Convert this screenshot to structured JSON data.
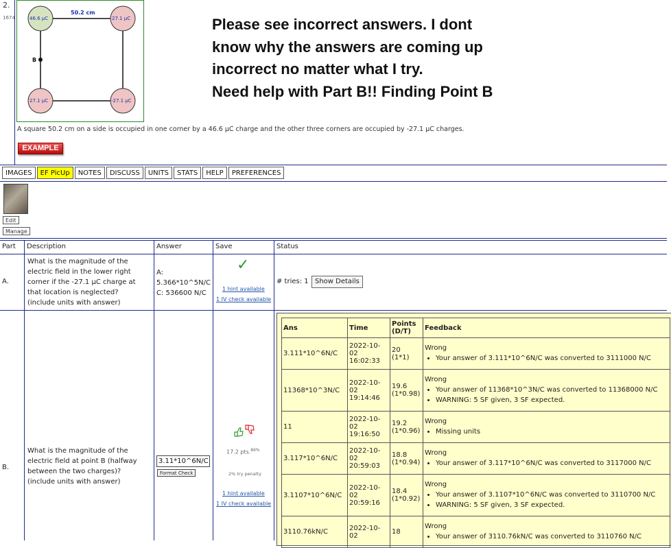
{
  "question": {
    "number": "2.",
    "id": "1674",
    "diagram": {
      "side_label": "50.2 cm",
      "point_label": "B",
      "charges": [
        "46.6 μC",
        "27.1 μC",
        "27.1 μC",
        "-27.1 μC"
      ]
    },
    "problem_text": "A square 50.2 cm on a side is occupied in one corner by a 46.6 μC charge and the other three corners are occupied by -27.1 μC charges.",
    "example_label": "EXAMPLE"
  },
  "note": {
    "lines": [
      "Please see incorrect answers. I dont",
      "know why the answers are coming up",
      "incorrect no matter what I try.",
      "Need help with Part B!! Finding Point B"
    ]
  },
  "tabs": [
    "IMAGES",
    "EF PicUp",
    "NOTES",
    "DISCUSS",
    "UNITS",
    "STATS",
    "HELP",
    "PREFERENCES"
  ],
  "image_panel": {
    "edit": "Edit",
    "manage": "Manage"
  },
  "table": {
    "headers": {
      "part": "Part",
      "description": "Description",
      "answer": "Answer",
      "save": "Save",
      "status": "Status"
    },
    "partA": {
      "part": "A.",
      "description": [
        "What is the magnitude of the",
        "electric field in the lower right",
        "corner if the -27.1 μC charge at",
        "that location is neglected?",
        "(include units with answer)"
      ],
      "answer": [
        "A:",
        "5.366*10^5N/C",
        "C: 536600 N/C"
      ],
      "hint": "1 hint available",
      "check": "1 IV check available",
      "tries": "# tries: 1",
      "show_details": "Show Details"
    },
    "partB": {
      "part": "B.",
      "description": [
        "What is the magnitude of the",
        "electric field at point B (halfway",
        "between the two charges)?",
        "(include units with answer)"
      ],
      "answer_value": "3.11*10^6N/C",
      "format_check": "Format Check",
      "points": "17.2 pts.",
      "points_pct": "86%",
      "penalty": "2% try penalty",
      "hint": "1 hint available",
      "check": "1 IV check available"
    }
  },
  "history": {
    "headers": {
      "ans": "Ans",
      "time": "Time",
      "points_1": "Points",
      "points_2": "(D/T)",
      "feedback": "Feedback"
    },
    "rows": [
      {
        "ans": "3.111*10^6N/C",
        "date": "2022-10-02",
        "time": "16:02:33",
        "points": "20",
        "factor": "(1*1)",
        "status": "Wrong",
        "notes": [
          "Your answer of 3.111*10^6N/C was converted to 3111000 N/C"
        ]
      },
      {
        "ans": "11368*10^3N/C",
        "date": "2022-10-02",
        "time": "19:14:46",
        "points": "19.6",
        "factor": "(1*0.98)",
        "status": "Wrong",
        "notes": [
          "Your answer of 11368*10^3N/C was converted to 11368000 N/C",
          "WARNING: 5 SF given, 3 SF expected."
        ]
      },
      {
        "ans": "11",
        "date": "2022-10-02",
        "time": "19:16:50",
        "points": "19.2",
        "factor": "(1*0.96)",
        "status": "Wrong",
        "notes": [
          "Missing units"
        ]
      },
      {
        "ans": "3.117*10^6N/C",
        "date": "2022-10-02",
        "time": "20:59:03",
        "points": "18.8",
        "factor": "(1*0.94)",
        "status": "Wrong",
        "notes": [
          "Your answer of 3.117*10^6N/C was converted to 3117000 N/C"
        ]
      },
      {
        "ans": "3.1107*10^6N/C",
        "date": "2022-10-02",
        "time": "20:59:16",
        "points": "18.4",
        "factor": "(1*0.92)",
        "status": "Wrong",
        "notes": [
          "Your answer of 3.1107*10^6N/C was converted to 3110700 N/C",
          "WARNING: 5 SF given, 3 SF expected."
        ]
      },
      {
        "ans": "3110.76kN/C",
        "date": "2022-10-02",
        "time": "",
        "points": "18",
        "factor": "",
        "status": "Wrong",
        "notes": [
          "Your answer of 3110.76kN/C was converted to 3110760 N/C"
        ]
      }
    ]
  },
  "colors": {
    "accent_line": "#1f2a8a",
    "highlight_tab": "#ffff00",
    "history_bg": "#ffffcc",
    "positive_charge": "#d6e3c0",
    "negative_charge": "#efc4c4"
  }
}
